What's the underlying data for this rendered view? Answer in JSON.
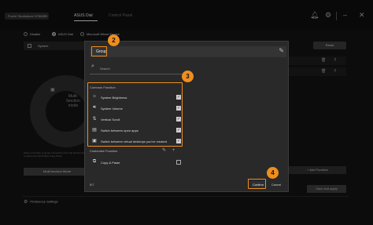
{
  "topbar": {
    "device": "ProArt Studiobook H7600ZX",
    "tabs": [
      "ASUS Dial",
      "Control Panel"
    ]
  },
  "modes": [
    "Disable",
    "ASUS Dial",
    "Microsoft Wheel Device"
  ],
  "system_bar": {
    "label": "System"
  },
  "reset_label": "Reset",
  "dial": {
    "center_label": "Multi-function mode"
  },
  "hint": "Select a function or group of functions from the function list to add to the ASUS Dial. Long Press",
  "multi_function_button": "Multi-function Mode",
  "add_function_button": "+ Add Function",
  "save_button": "Save and apply",
  "preference": "Preference Settings",
  "dialog": {
    "group_name": "Group",
    "search_placeholder": "Search",
    "common_function_label": "Common Function",
    "common_functions": [
      {
        "label": "System Brightness",
        "icon": "brightness-icon",
        "checked": true
      },
      {
        "label": "System Volume",
        "icon": "volume-icon",
        "checked": true
      },
      {
        "label": "Vertical Scroll",
        "icon": "scroll-icon",
        "checked": true
      },
      {
        "label": "Switch between open apps",
        "icon": "app-switch-icon",
        "checked": true
      },
      {
        "label": "Switch between virtual desktops you've created",
        "icon": "virtual-desktop-icon",
        "checked": true
      }
    ],
    "custom_function_label": "Customize Function",
    "custom_functions": [
      {
        "label": "Copy & Paste",
        "icon": "copy-paste-icon",
        "checked": false
      }
    ],
    "page_count": "5/7",
    "confirm": "Confirm",
    "cancel": "Cancel"
  },
  "callouts": [
    "2",
    "3",
    "4"
  ],
  "colors": {
    "highlight": "#ef8e1f",
    "dialog_bg": "#292929",
    "app_bg": "#131313"
  }
}
